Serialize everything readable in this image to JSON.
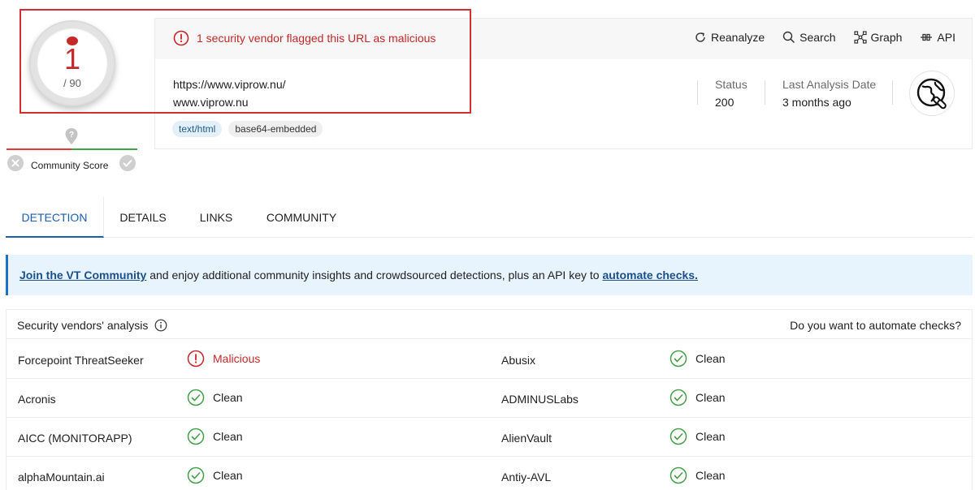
{
  "score": {
    "detections": "1",
    "total": "/ 90"
  },
  "community": {
    "label": "Community Score"
  },
  "alert": {
    "text": "1 security vendor flagged this URL as malicious"
  },
  "toolbar": {
    "reanalyze": "Reanalyze",
    "search": "Search",
    "graph": "Graph",
    "api": "API"
  },
  "url": {
    "full": "https://www.viprow.nu/",
    "host": "www.viprow.nu"
  },
  "tags": [
    "text/html",
    "base64-embedded"
  ],
  "meta": {
    "status_label": "Status",
    "status_value": "200",
    "date_label": "Last Analysis Date",
    "date_value": "3 months ago"
  },
  "tabs": [
    "DETECTION",
    "DETAILS",
    "LINKS",
    "COMMUNITY"
  ],
  "banner": {
    "link1": "Join the VT Community",
    "middle": " and enjoy additional community insights and crowdsourced detections, plus an API key to ",
    "link2": "automate checks."
  },
  "vendors": {
    "title": "Security vendors' analysis",
    "automate": "Do you want to automate checks?",
    "rows": [
      {
        "left_name": "Forcepoint ThreatSeeker",
        "left_result": "Malicious",
        "right_name": "Abusix",
        "right_result": "Clean"
      },
      {
        "left_name": "Acronis",
        "left_result": "Clean",
        "right_name": "ADMINUSLabs",
        "right_result": "Clean"
      },
      {
        "left_name": "AICC (MONITORAPP)",
        "left_result": "Clean",
        "right_name": "AlienVault",
        "right_result": "Clean"
      },
      {
        "left_name": "alphaMountain.ai",
        "left_result": "Clean",
        "right_name": "Antiy-AVL",
        "right_result": "Clean"
      }
    ]
  },
  "colors": {
    "malicious": "#c62828",
    "clean": "#43a047",
    "link": "#1b4f8a",
    "accent": "#1a5fb4"
  }
}
